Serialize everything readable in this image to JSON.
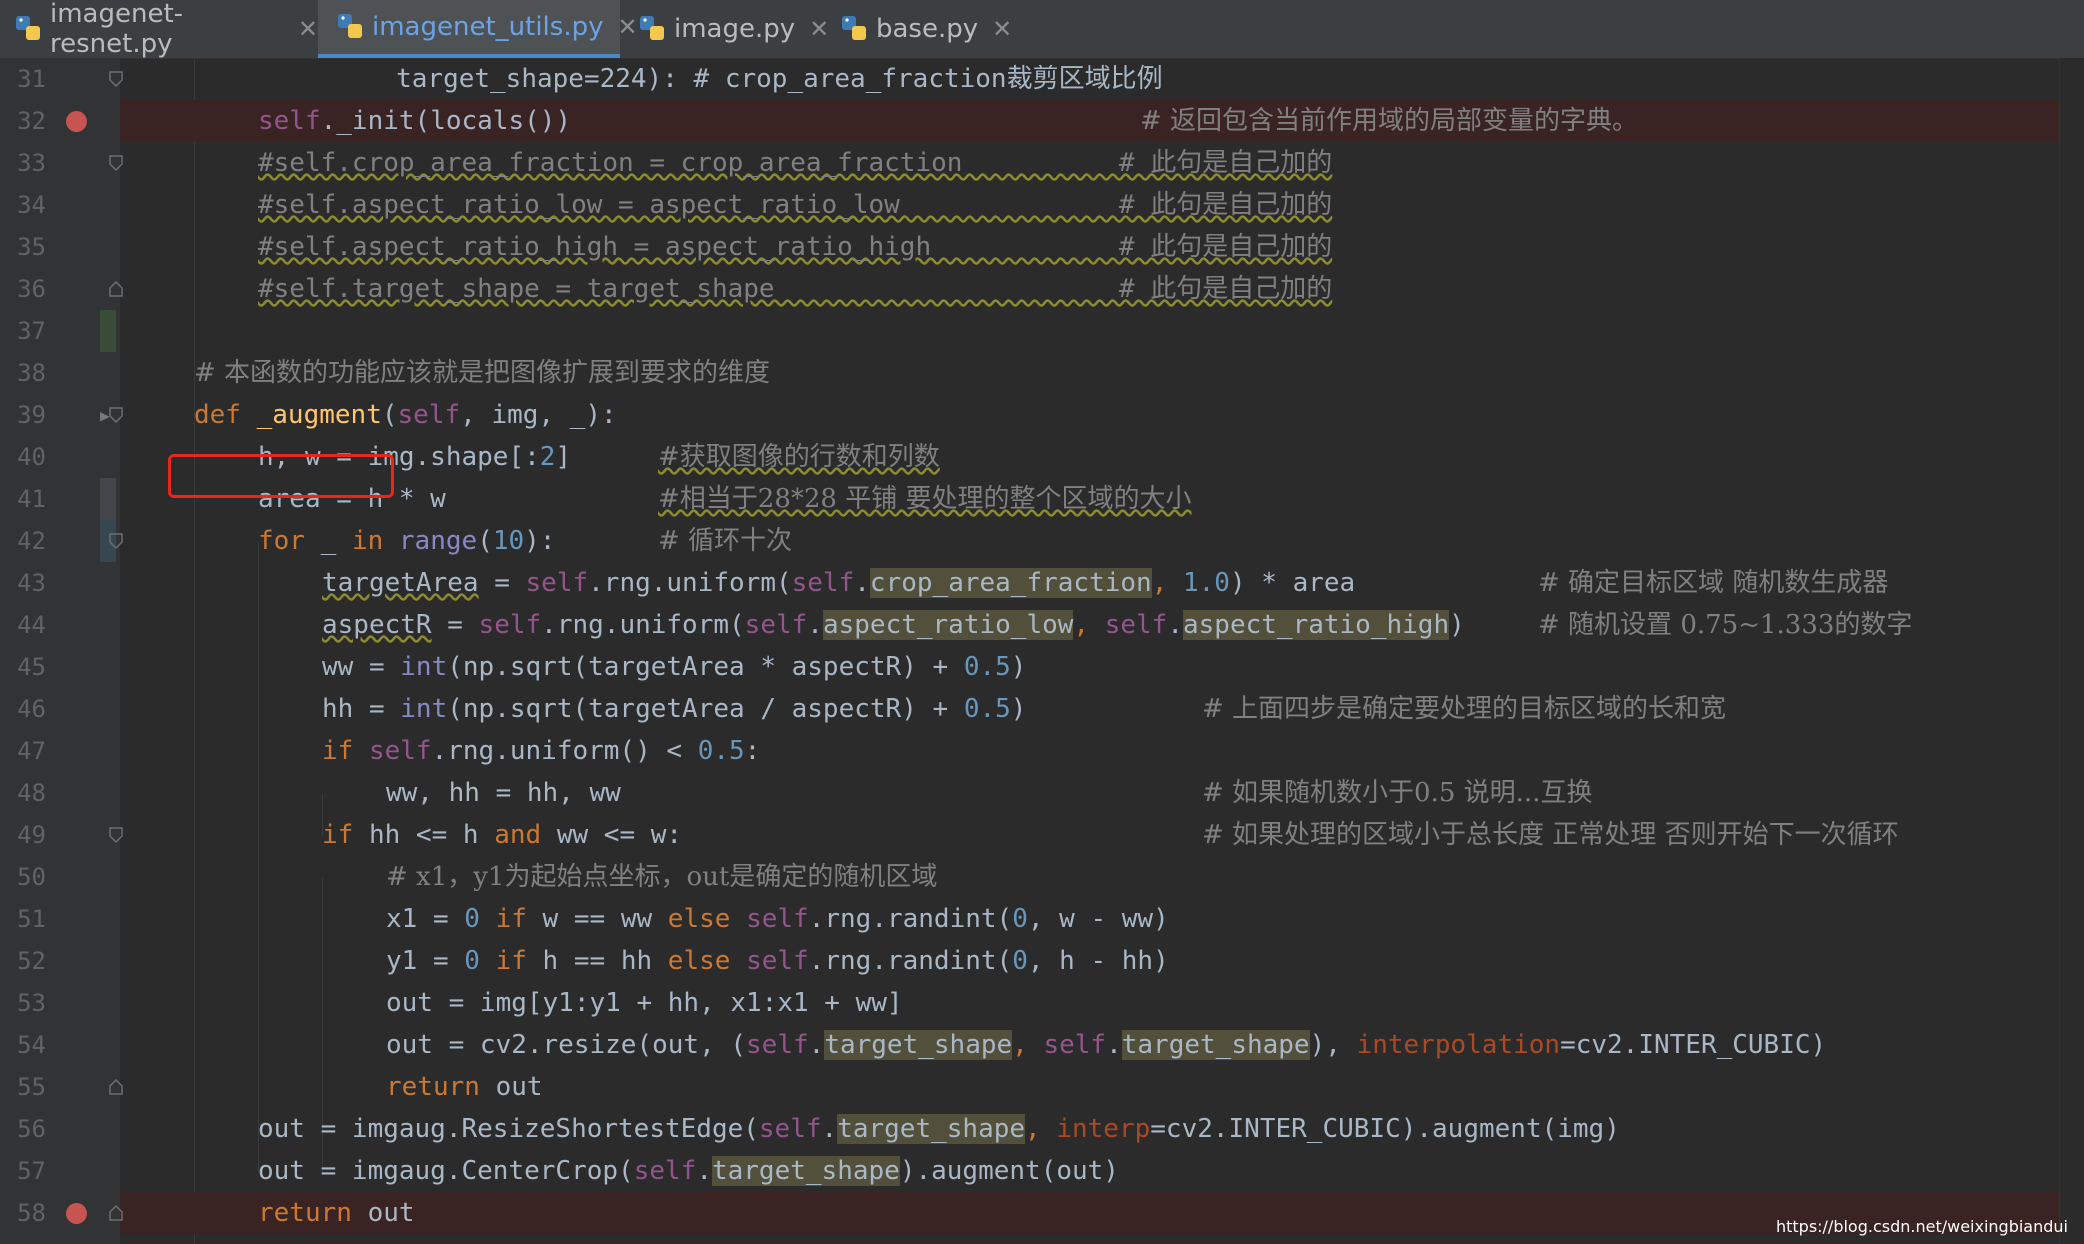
{
  "tabs": [
    {
      "label": "imagenet-resnet.py",
      "active": false
    },
    {
      "label": "imagenet_utils.py",
      "active": true
    },
    {
      "label": "image.py",
      "active": false
    },
    {
      "label": "base.py",
      "active": false
    }
  ],
  "lines": [
    {
      "n": "31",
      "bp": false
    },
    {
      "n": "32",
      "bp": true
    },
    {
      "n": "33",
      "bp": false
    },
    {
      "n": "34",
      "bp": false
    },
    {
      "n": "35",
      "bp": false
    },
    {
      "n": "36",
      "bp": false
    },
    {
      "n": "37",
      "bp": false
    },
    {
      "n": "38",
      "bp": false
    },
    {
      "n": "39",
      "bp": false
    },
    {
      "n": "40",
      "bp": false
    },
    {
      "n": "41",
      "bp": false
    },
    {
      "n": "42",
      "bp": false
    },
    {
      "n": "43",
      "bp": false
    },
    {
      "n": "44",
      "bp": false
    },
    {
      "n": "45",
      "bp": false
    },
    {
      "n": "46",
      "bp": false
    },
    {
      "n": "47",
      "bp": false
    },
    {
      "n": "48",
      "bp": false
    },
    {
      "n": "49",
      "bp": false
    },
    {
      "n": "50",
      "bp": false
    },
    {
      "n": "51",
      "bp": false
    },
    {
      "n": "52",
      "bp": false
    },
    {
      "n": "53",
      "bp": false
    },
    {
      "n": "54",
      "bp": false
    },
    {
      "n": "55",
      "bp": false
    },
    {
      "n": "56",
      "bp": false
    },
    {
      "n": "57",
      "bp": false
    },
    {
      "n": "58",
      "bp": true
    }
  ],
  "code": {
    "l31": "                 target_shape=224): # crop_area_fraction裁剪区域比例",
    "l32a": "self",
    "l32b": "._init(locals())",
    "l32c": "# 返回包含当前作用域的局部变量的字典。",
    "l33": "#self.crop_area_fraction = crop_area_fraction          # 此句是自己加的",
    "l34": "#self.aspect_ratio_low = aspect_ratio_low              # 此句是自己加的",
    "l35": "#self.aspect_ratio_high = aspect_ratio_high            # 此句是自己加的",
    "l36": "#self.target_shape = target_shape                      # 此句是自己加的",
    "l38": "# 本函数的功能应该就是把图像扩展到要求的维度",
    "l39_def": "def ",
    "l39_fn": "_augment",
    "l39_open": "(",
    "l39_self": "self",
    "l39_rest": ", img, _):",
    "l40a": "h, w = img.shape[:",
    "l40n": "2",
    "l40b": "]",
    "l40c": "#获取图像的行数和列数",
    "l41a": "area = h * w",
    "l41c": "#相当于28*28 平铺 要处理的整个区域的大小",
    "l42k": "for",
    "l42a": " _ ",
    "l42in": "in",
    "l42sp": " ",
    "l42r": "range",
    "l42b": "(",
    "l42n": "10",
    "l42e": "):",
    "l42c": "# 循环十次",
    "l43v": "targetArea",
    "l43a": " = ",
    "l43s": "self",
    "l43b": ".rng.uniform(",
    "l43s2": "self",
    "l43d": ".",
    "l43h": "crop_area_fraction",
    "l43e": ", ",
    "l43n": "1.0",
    "l43f": ") * area",
    "l43c": "# 确定目标区域 随机数生成器",
    "l44v": "aspectR",
    "l44a": " = ",
    "l44s": "self",
    "l44b": ".rng.uniform(",
    "l44s2": "self",
    "l44d": ".",
    "l44h": "aspect_ratio_low",
    "l44e": ", ",
    "l44s3": "self",
    "l44d2": ".",
    "l44h2": "aspect_ratio_high",
    "l44f": ")",
    "l44c": "# 随机设置 0.75~1.333的数字",
    "l45a": "ww = ",
    "l45b": "int",
    "l45c": "(np.sqrt(targetArea * aspectR) + ",
    "l45n": "0.5",
    "l45e": ")",
    "l46a": "hh = ",
    "l46b": "int",
    "l46c": "(np.sqrt(targetArea / aspectR) + ",
    "l46n": "0.5",
    "l46e": ")",
    "l46cm": "# 上面四步是确定要处理的目标区域的长和宽",
    "l47k": "if ",
    "l47s": "self",
    "l47a": ".rng.uniform() < ",
    "l47n": "0.5",
    "l47e": ":",
    "l48a": "ww, hh = hh, ww",
    "l48c": "# 如果随机数小于0.5 说明...互换",
    "l49k": "if",
    "l49a": " hh <= h ",
    "l49and": "and",
    "l49b": " ww <= w:",
    "l49c": "# 如果处理的区域小于总长度 正常处理 否则开始下一次循环",
    "l50": "# x1，y1为起始点坐标，out是确定的随机区域",
    "l51a": "x1 = ",
    "l51n": "0",
    "l51k": " if",
    "l51b": " w == ww ",
    "l51else": "else",
    "l51sp": " ",
    "l51s": "self",
    "l51c": ".rng.randint(",
    "l51n2": "0",
    "l51d": ", w - ww)",
    "l52a": "y1 = ",
    "l52n": "0",
    "l52k": " if",
    "l52b": " h == hh ",
    "l52else": "else",
    "l52sp": " ",
    "l52s": "self",
    "l52c": ".rng.randint(",
    "l52n2": "0",
    "l52d": ", h - hh)",
    "l53": "out = img[y1:y1 + hh, x1:x1 + ww]",
    "l54a": "out = cv2.resize(out, (",
    "l54s": "self",
    "l54d": ".",
    "l54h": "target_shape",
    "l54e": ", ",
    "l54s2": "self",
    "l54d2": ".",
    "l54h2": "target_shape",
    "l54f": "), ",
    "l54p": "interpolation",
    "l54g": "=cv2.INTER_CUBIC)",
    "l55k": "return",
    "l55a": " out",
    "l56a": "out = imgaug.ResizeShortestEdge(",
    "l56s": "self",
    "l56d": ".",
    "l56h": "target_shape",
    "l56e": ", ",
    "l56p": "interp",
    "l56f": "=cv2.INTER_CUBIC).augment(img)",
    "l57a": "out = imgaug.CenterCrop(",
    "l57s": "self",
    "l57d": ".",
    "l57h": "target_shape",
    "l57e": ").augment(out)",
    "l58k": "return",
    "l58a": " out"
  },
  "watermark": "https://blog.csdn.net/weixingbiandui",
  "colors": {
    "background": "#2b2b2b",
    "keyword": "#cc7832",
    "self": "#94558d",
    "number": "#6897bb",
    "comment": "#808080",
    "function": "#ffc66d",
    "breakpoint": "#c75450",
    "highlight_box": "#e8261c"
  }
}
